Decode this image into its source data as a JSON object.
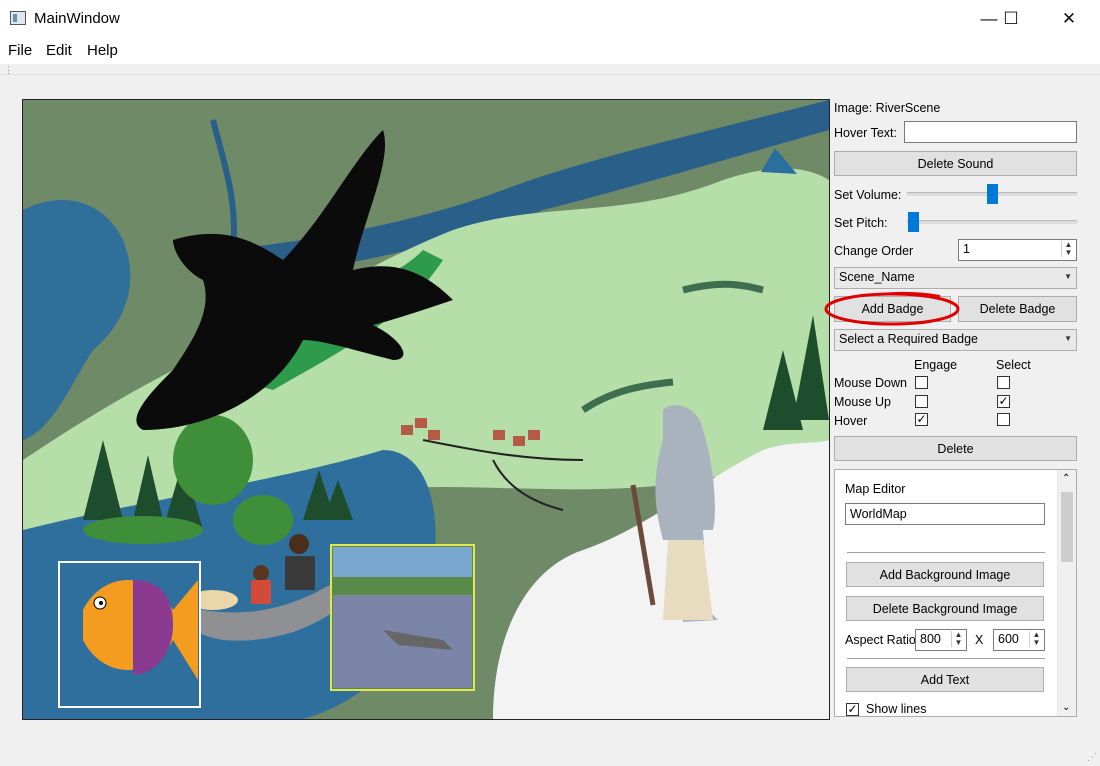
{
  "window": {
    "title": "MainWindow",
    "minimize_glyph": "—",
    "maximize_glyph": "☐",
    "close_glyph": "✕"
  },
  "menu": {
    "file": "File",
    "edit": "Edit",
    "help": "Help"
  },
  "panel": {
    "image_label": "Image: RiverScene",
    "hover_text_label": "Hover Text:",
    "hover_text_value": "",
    "delete_sound": "Delete Sound",
    "set_volume_label": "Set Volume:",
    "volume_level": 0.5,
    "set_pitch_label": "Set Pitch:",
    "pitch_level": 0.0,
    "change_order_label": "Change Order",
    "change_order_value": "1",
    "scene_combo": "Scene_Name",
    "add_badge": "Add Badge",
    "delete_badge": "Delete Badge",
    "required_badge_combo": "Select a Required Badge",
    "engage_header": "Engage",
    "select_header": "Select",
    "rows": [
      {
        "label": "Mouse Down",
        "engage": false,
        "select": false
      },
      {
        "label": "Mouse Up",
        "engage": false,
        "select": true
      },
      {
        "label": "Hover",
        "engage": true,
        "select": false
      }
    ],
    "delete": "Delete"
  },
  "map_editor": {
    "title": "Map Editor",
    "map_name": "WorldMap",
    "add_background": "Add Background Image",
    "delete_background": "Delete Background Image",
    "aspect_label": "Aspect Ratio",
    "aspect_w": "800",
    "aspect_x": "X",
    "aspect_h": "600",
    "add_text": "Add Text",
    "show_lines": "Show lines",
    "show_lines_checked": true
  },
  "colors": {
    "accent": "#0078d7",
    "annotation_red": "#e00000"
  }
}
